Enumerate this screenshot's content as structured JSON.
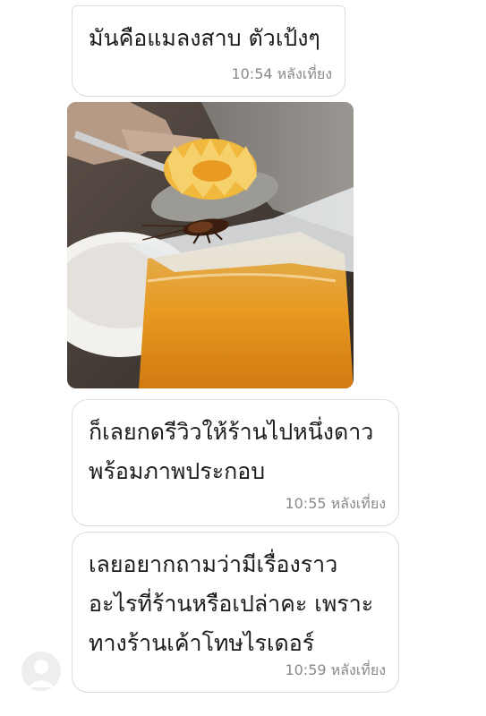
{
  "messages": [
    {
      "text": "มันคือแมลงสาบ ตัวเป้งๆ",
      "time": "10:54 หลังเที่ยง"
    },
    {
      "text": "ก็เลยกดรีวิวให้ร้านไปหนึ่งดาว\nพร้อมภาพประกอบ",
      "time": "10:55 หลังเที่ยง"
    },
    {
      "text": "เลยอยากถามว่ามีเรื่องราว\nอะไรที่ร้านหรือเปล่าคะ เพราะ\nทางร้านเค้าโทษไรเดอร์",
      "time": "10:59 หลังเที่ยง"
    }
  ],
  "colors": {
    "bubble_border": "#dcdcdc",
    "time_text": "#8a8a8a",
    "avatar_bg": "#eeeeee"
  }
}
